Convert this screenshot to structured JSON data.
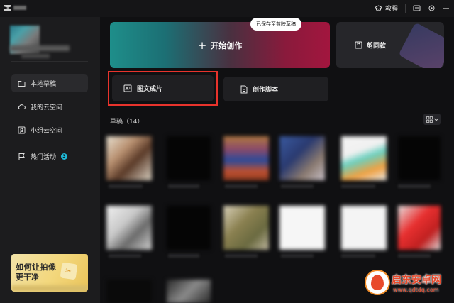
{
  "titlebar": {
    "tutorial_label": "教程"
  },
  "sidebar": {
    "items": [
      {
        "label": "本地草稿",
        "icon": "folder-icon",
        "active": true
      },
      {
        "label": "我的云空间",
        "icon": "cloud-icon",
        "active": false
      },
      {
        "label": "小组云空间",
        "icon": "team-icon",
        "active": false
      },
      {
        "label": "热门活动",
        "icon": "flag-icon",
        "active": false,
        "badge": "3"
      }
    ],
    "promo": {
      "line1": "如何让拍像",
      "line2": "更干净"
    }
  },
  "main": {
    "start_label": "开始创作",
    "tooltip": "已保存至剪映草稿",
    "cut_label": "剪同款",
    "image_to_video_label": "图文成片",
    "script_label": "创作脚本",
    "drafts_label": "草稿（14）"
  },
  "watermark": {
    "title": "启东安卓网",
    "url": "www.qdtdq.com"
  },
  "colors": {
    "accent_teal": "#1e8e8a",
    "accent_red": "#a2163e",
    "highlight_border": "#e8332c",
    "badge": "#1fb7d6"
  }
}
